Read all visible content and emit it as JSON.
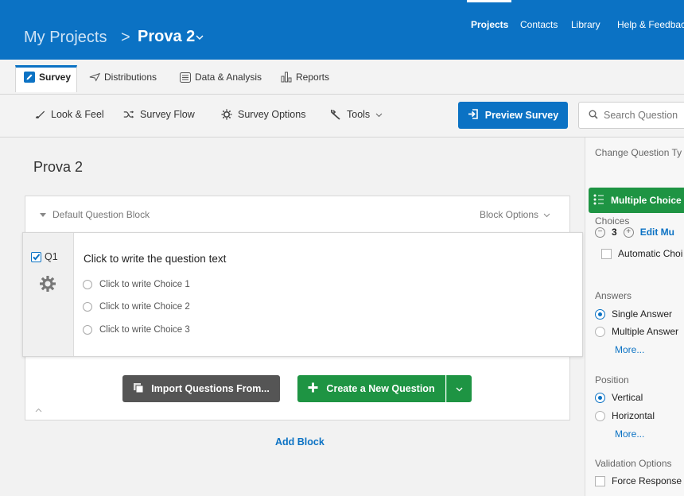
{
  "header": {
    "breadcrumb_root": "My Projects",
    "breadcrumb_separator": ">",
    "breadcrumb_current": "Prova 2",
    "nav": [
      "Projects",
      "Contacts",
      "Library",
      "Help & Feedbac"
    ]
  },
  "tabs": [
    "Survey",
    "Distributions",
    "Data & Analysis",
    "Reports"
  ],
  "toolbar": {
    "look_feel": "Look & Feel",
    "survey_flow": "Survey Flow",
    "survey_options": "Survey Options",
    "tools": "Tools",
    "preview": "Preview Survey",
    "search_placeholder": "Search Question"
  },
  "survey": {
    "title": "Prova 2",
    "block_name": "Default Question Block",
    "block_options": "Block Options",
    "question": {
      "number": "Q1",
      "text": "Click to write the question text",
      "choices": [
        "Click to write Choice 1",
        "Click to write Choice 2",
        "Click to write Choice 3"
      ]
    },
    "import_button": "Import Questions From...",
    "create_button": "Create a New Question",
    "add_block": "Add Block"
  },
  "right_panel": {
    "change_type_label": "Change Question Ty",
    "question_type": "Multiple Choice",
    "choices_label": "Choices",
    "choices_count": "3",
    "edit_multiple": "Edit Mu",
    "automatic_choices": "Automatic Choi",
    "answers_label": "Answers",
    "answer_options": [
      "Single Answer",
      "Multiple Answer"
    ],
    "more": "More...",
    "position_label": "Position",
    "position_options": [
      "Vertical",
      "Horizontal"
    ],
    "validation_label": "Validation Options",
    "force_response": "Force Response"
  },
  "colors": {
    "brand_blue": "#0b72c4",
    "action_green": "#1e9443",
    "import_gray": "#555555"
  }
}
